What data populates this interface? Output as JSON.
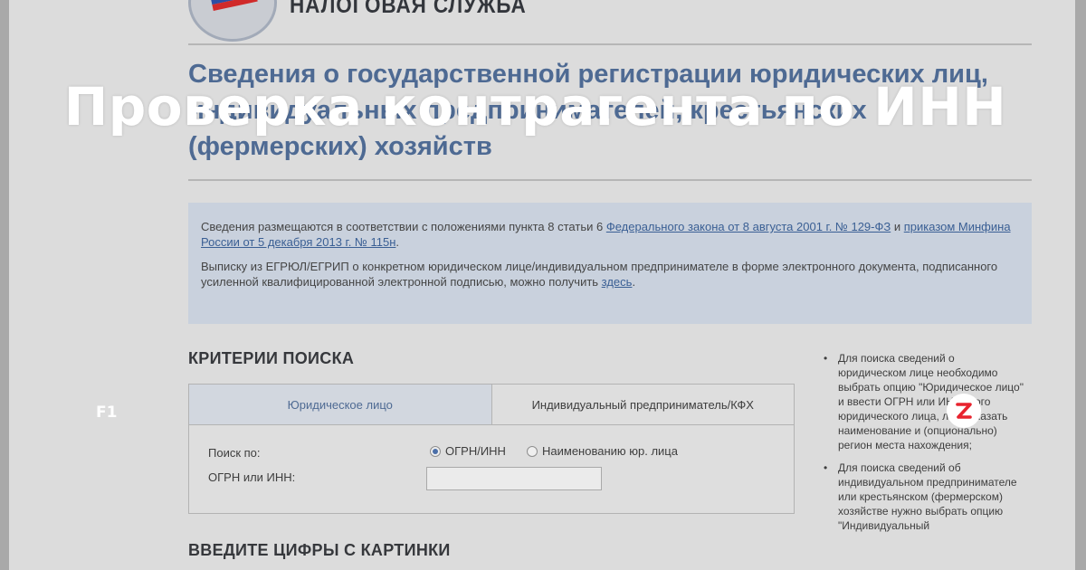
{
  "header": {
    "service_name": "НАЛОГОВАЯ СЛУЖБА",
    "flag_colors": [
      "#ffffff",
      "#2d4ea3",
      "#d02a2a"
    ]
  },
  "page_title": "Сведения о государственной регистрации юридических лиц, индивидуальных предпринимателей, крестьянских (фермерских) хозяйств",
  "info": {
    "p1_text": "Сведения размещаются в соответствии с положениями пункта 8 статьи 6 ",
    "p1_link1": "Федерального закона от 8 августа 2001 г. № 129-ФЗ",
    "p1_and": " и ",
    "p1_link2": "приказом Минфина России от 5 декабря 2013 г. № 115н",
    "p1_end": ".",
    "p2_text": "Выписку из ЕГРЮЛ/ЕГРИП о конкретном юридическом лице/индивидуальном предпринимателе в форме электронного документа, подписанного усиленной квалифицированной электронной подписью, можно получить ",
    "p2_link": "здесь",
    "p2_end": "."
  },
  "search": {
    "heading": "КРИТЕРИИ ПОИСКА",
    "tabs": [
      "Юридическое лицо",
      "Индивидуальный предприниматель/КФХ"
    ],
    "search_by_label": "Поиск по:",
    "radio_ogrn": "ОГРН/ИНН",
    "radio_name": "Наименованию юр. лица",
    "inn_label": "ОГРН или ИНН:",
    "inn_value": ""
  },
  "captcha": {
    "heading": "ВВЕДИТЕ ЦИФРЫ С КАРТИНКИ"
  },
  "hints": [
    "Для поиска сведений о юридическом лице необходимо выбрать опцию \"Юридическое лицо\" и ввести ОГРН или ИНН этого юридического лица, либо указать наименование и (опционально) регион места нахождения;",
    "Для поиска сведений об индивидуальном предпринимателе или крестьянском (фермерском) хозяйстве нужно выбрать опцию \"Индивидуальный"
  ],
  "overlay": {
    "title": "Проверка контрагента по ИНН",
    "channel_label": "F1",
    "zen_icon": "zen-logo-icon",
    "zen_color": "#e8232e"
  }
}
